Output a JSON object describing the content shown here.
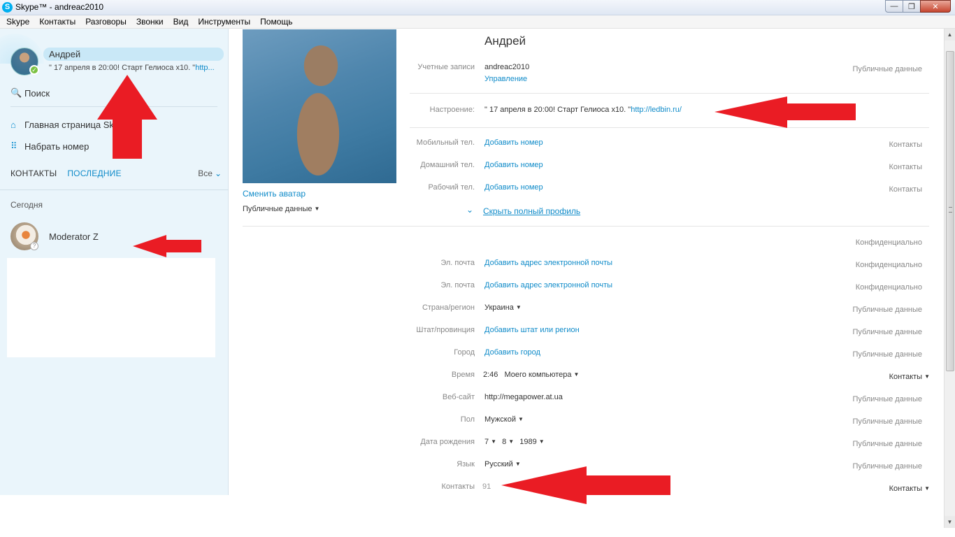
{
  "window": {
    "app_icon": "S",
    "title": "Skype™ - andreac2010",
    "buttons": {
      "minimize": "—",
      "maximize": "❐",
      "close": "✕"
    }
  },
  "menu": [
    "Skype",
    "Контакты",
    "Разговоры",
    "Звонки",
    "Вид",
    "Инструменты",
    "Помощь"
  ],
  "sidebar": {
    "me": {
      "name": "Андрей",
      "mood_text": "\" 17 апреля в 20:00! Старт Гелиоса х10. \"",
      "mood_link": "http...",
      "status_mark": "✓"
    },
    "search_label": "Поиск",
    "search_icon": "🔍",
    "nav": [
      {
        "icon": "home-icon",
        "glyph": "⌂",
        "label": "Главная страница Skype"
      },
      {
        "icon": "dialpad-icon",
        "glyph": "⠿",
        "label": "Набрать номер"
      }
    ],
    "tabs": {
      "contacts": "КОНТАКТЫ",
      "recent": "ПОСЛЕДНИЕ",
      "filter": "Все",
      "filter_chevron": "⌄"
    },
    "section_today": "Сегодня",
    "recent_contacts": [
      {
        "name": "Moderator Z",
        "status_mark": "?"
      }
    ]
  },
  "profile": {
    "change_avatar": "Сменить аватар",
    "public_dropdown": "Публичные данные",
    "caret": "▼",
    "expand_chevron": "⌄",
    "name": "Андрей",
    "accounts": {
      "label": "Учетные записи",
      "value": "andreac2010",
      "manage": "Управление",
      "privacy": "Публичные данные"
    },
    "mood": {
      "label": "Настроение:",
      "text": "\" 17 апреля в 20:00! Старт Гелиоса х10. \"",
      "link": "http://ledbin.ru/"
    },
    "phones": [
      {
        "label": "Мобильный тел.",
        "value": "Добавить номер",
        "privacy": "Контакты"
      },
      {
        "label": "Домашний тел.",
        "value": "Добавить номер",
        "privacy": "Контакты"
      },
      {
        "label": "Рабочий тел.",
        "value": "Добавить номер",
        "privacy": "Контакты"
      }
    ],
    "hide_full_profile": "Скрыть полный профиль",
    "confidential_header": "Конфиденциально",
    "details": {
      "email1": {
        "label": "Эл. почта",
        "value": "Добавить адрес электронной почты",
        "privacy": "Конфиденциально"
      },
      "email2": {
        "label": "Эл. почта",
        "value": "Добавить адрес электронной почты",
        "privacy": "Конфиденциально"
      },
      "country": {
        "label": "Страна/регион",
        "value": "Украина",
        "privacy": "Публичные данные"
      },
      "state": {
        "label": "Штат/провинция",
        "value": "Добавить штат или регион",
        "privacy": "Публичные данные"
      },
      "city": {
        "label": "Город",
        "value": "Добавить город",
        "privacy": "Публичные данные"
      },
      "time": {
        "label": "Время",
        "clock": "2:46",
        "zone": "Моего компьютера",
        "privacy": "Контакты"
      },
      "website": {
        "label": "Веб-сайт",
        "value": "http://megapower.at.ua",
        "privacy": "Публичные данные"
      },
      "gender": {
        "label": "Пол",
        "value": "Мужской",
        "privacy": "Публичные данные"
      },
      "birthday": {
        "label": "Дата рождения",
        "day": "7",
        "month": "8",
        "year": "1989",
        "privacy": "Публичные данные"
      },
      "language": {
        "label": "Язык",
        "value": "Русский",
        "privacy": "Публичные данные"
      },
      "contacts": {
        "label": "Контакты",
        "value": "91",
        "privacy": "Контакты"
      }
    }
  },
  "scrollbar": {
    "up": "▲",
    "down": "▼"
  },
  "colors": {
    "skype_blue": "#00aff0",
    "link": "#0f8bc9",
    "sidebar_bg": "#eaf5fb",
    "annotation_red": "#ea1c24"
  }
}
